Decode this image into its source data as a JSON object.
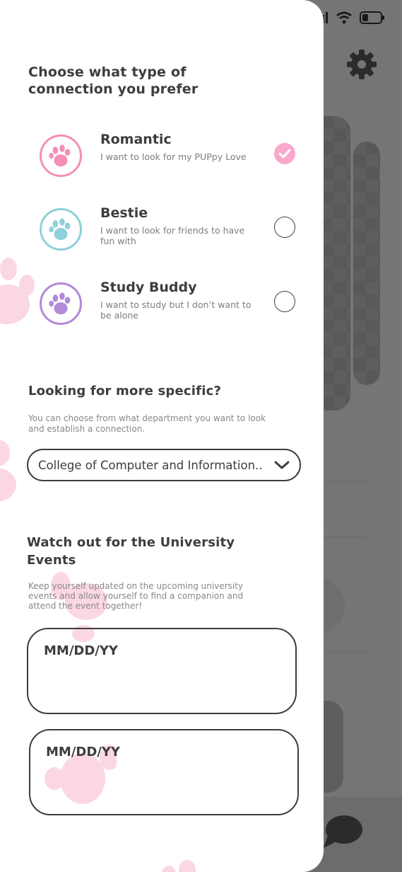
{
  "connection": {
    "title": "Choose what type of connection you prefer",
    "options": [
      {
        "name": "Romantic",
        "description": "I want to look for my PUPpy Love",
        "color": "#f48fb8",
        "selected": true
      },
      {
        "name": "Bestie",
        "description": "I want to look for friends to have fun with",
        "color": "#8fd0db",
        "selected": false
      },
      {
        "name": "Study Buddy",
        "description": "I want to study but I don’t want to be alone",
        "color": "#b18ad8",
        "selected": false
      }
    ]
  },
  "specific": {
    "title": "Looking for more specific?",
    "subtitle": "You can choose from what department you want to look and establish a connection.",
    "department_value": "College of Computer and Information.."
  },
  "events": {
    "title": "Watch out for the University Events",
    "subtitle": "Keep yourself updated on the upcoming university events and allow yourself to find a companion and attend the event together!",
    "date1_placeholder": "MM/DD/YY",
    "date2_placeholder": "MM/DD/YY"
  },
  "colors": {
    "accent_pink": "#f9a8cc",
    "text_dark": "#3d3d3d",
    "overlay_gray": "#757575"
  },
  "icons": [
    "paw-icon",
    "checkmark-icon",
    "chevron-down-icon",
    "settings-gear-icon",
    "chat-bubble-icon",
    "wifi-icon",
    "battery-icon",
    "signal-icon"
  ]
}
